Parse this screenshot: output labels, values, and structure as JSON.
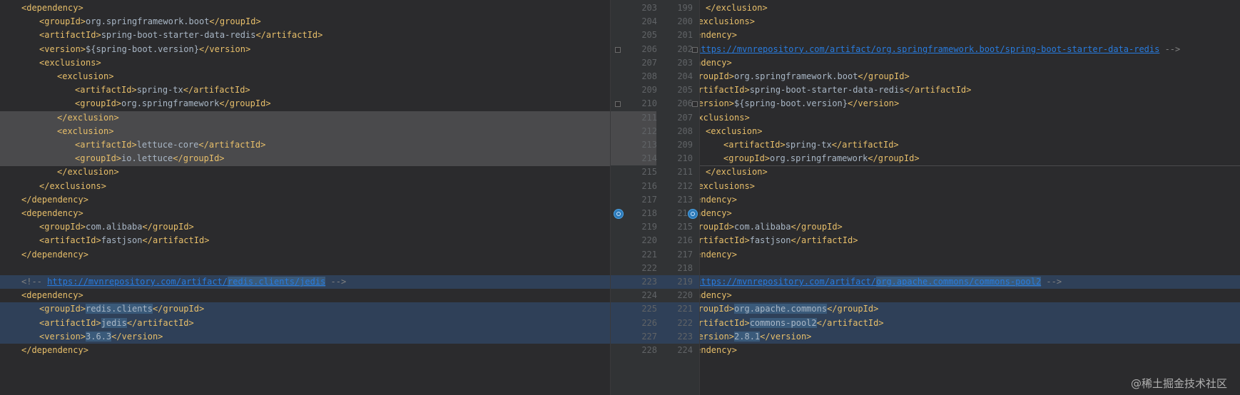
{
  "left_lines": [
    {
      "tokens": [
        {
          "t": "tag",
          "v": "<dependency>"
        }
      ],
      "indent": 0
    },
    {
      "tokens": [
        {
          "t": "tag",
          "v": "<groupId>"
        },
        {
          "t": "txt",
          "v": "org.springframework.boot"
        },
        {
          "t": "tag",
          "v": "</groupId>"
        }
      ],
      "indent": 1
    },
    {
      "tokens": [
        {
          "t": "tag",
          "v": "<artifactId>"
        },
        {
          "t": "txt",
          "v": "spring-boot-starter-data-redis"
        },
        {
          "t": "tag",
          "v": "</artifactId>"
        }
      ],
      "indent": 1
    },
    {
      "tokens": [
        {
          "t": "tag",
          "v": "<version>"
        },
        {
          "t": "txt",
          "v": "${spring-boot.version}"
        },
        {
          "t": "tag",
          "v": "</version>"
        }
      ],
      "indent": 1
    },
    {
      "tokens": [
        {
          "t": "tag",
          "v": "<exclusions>"
        }
      ],
      "indent": 1
    },
    {
      "tokens": [
        {
          "t": "tag",
          "v": "<exclusion>"
        }
      ],
      "indent": 2
    },
    {
      "tokens": [
        {
          "t": "tag",
          "v": "<artifactId>"
        },
        {
          "t": "txt",
          "v": "spring-tx"
        },
        {
          "t": "tag",
          "v": "</artifactId>"
        }
      ],
      "indent": 3
    },
    {
      "tokens": [
        {
          "t": "tag",
          "v": "<groupId>"
        },
        {
          "t": "txt",
          "v": "org.springframework"
        },
        {
          "t": "tag",
          "v": "</groupId>"
        }
      ],
      "indent": 3
    },
    {
      "tokens": [
        {
          "t": "tag",
          "v": "</exclusion>"
        }
      ],
      "indent": 2,
      "bg": "del"
    },
    {
      "tokens": [
        {
          "t": "tag",
          "v": "<exclusion>"
        }
      ],
      "indent": 2,
      "bg": "del"
    },
    {
      "tokens": [
        {
          "t": "tag",
          "v": "<artifactId>"
        },
        {
          "t": "txt",
          "v": "lettuce-core"
        },
        {
          "t": "tag",
          "v": "</artifactId>"
        }
      ],
      "indent": 3,
      "bg": "del"
    },
    {
      "tokens": [
        {
          "t": "tag",
          "v": "<groupId>"
        },
        {
          "t": "txt",
          "v": "io.lettuce"
        },
        {
          "t": "tag",
          "v": "</groupId>"
        }
      ],
      "indent": 3,
      "bg": "del"
    },
    {
      "tokens": [
        {
          "t": "tag",
          "v": "</exclusion>"
        }
      ],
      "indent": 2
    },
    {
      "tokens": [
        {
          "t": "tag",
          "v": "</exclusions>"
        }
      ],
      "indent": 1
    },
    {
      "tokens": [
        {
          "t": "tag",
          "v": "</dependency>"
        }
      ],
      "indent": 0
    },
    {
      "tokens": [
        {
          "t": "tag",
          "v": "<dependency>"
        }
      ],
      "indent": 0
    },
    {
      "tokens": [
        {
          "t": "tag",
          "v": "<groupId>"
        },
        {
          "t": "txt",
          "v": "com.alibaba"
        },
        {
          "t": "tag",
          "v": "</groupId>"
        }
      ],
      "indent": 1
    },
    {
      "tokens": [
        {
          "t": "tag",
          "v": "<artifactId>"
        },
        {
          "t": "txt",
          "v": "fastjson"
        },
        {
          "t": "tag",
          "v": "</artifactId>"
        }
      ],
      "indent": 1
    },
    {
      "tokens": [
        {
          "t": "tag",
          "v": "</dependency>"
        }
      ],
      "indent": 0
    },
    {
      "tokens": [],
      "indent": 0
    },
    {
      "tokens": [
        {
          "t": "cmt",
          "v": "<!-- "
        },
        {
          "t": "link",
          "v": "https://mvnrepository.com/artifact/"
        },
        {
          "t": "link hl-tok",
          "v": "redis.clients/jedis"
        },
        {
          "t": "cmt",
          "v": " -->"
        }
      ],
      "indent": 0,
      "bg": "chg"
    },
    {
      "tokens": [
        {
          "t": "tag",
          "v": "<dependency>"
        }
      ],
      "indent": 0
    },
    {
      "tokens": [
        {
          "t": "tag",
          "v": "<groupId>"
        },
        {
          "t": "txt hl-tok",
          "v": "redis.clients"
        },
        {
          "t": "tag",
          "v": "</groupId>"
        }
      ],
      "indent": 1,
      "bg": "chg"
    },
    {
      "tokens": [
        {
          "t": "tag",
          "v": "<artifactId>"
        },
        {
          "t": "txt hl-tok",
          "v": "jedis"
        },
        {
          "t": "tag",
          "v": "</artifactId>"
        }
      ],
      "indent": 1,
      "bg": "chg"
    },
    {
      "tokens": [
        {
          "t": "tag",
          "v": "<version>"
        },
        {
          "t": "txt hl-tok",
          "v": "3.6.3"
        },
        {
          "t": "tag",
          "v": "</version>"
        }
      ],
      "indent": 1,
      "bg": "chg"
    },
    {
      "tokens": [
        {
          "t": "tag",
          "v": "</dependency>"
        }
      ],
      "indent": 0
    }
  ],
  "right_lines": [
    {
      "tokens": [
        {
          "t": "tag",
          "v": "</exclusion>"
        }
      ],
      "indent": 2
    },
    {
      "tokens": [
        {
          "t": "tag",
          "v": "</exclusions>"
        }
      ],
      "indent": 1
    },
    {
      "tokens": [
        {
          "t": "tag",
          "v": "</dependency>"
        }
      ],
      "indent": 0
    },
    {
      "tokens": [
        {
          "t": "cmt",
          "v": "<!-- "
        },
        {
          "t": "link",
          "v": "https://mvnrepository.com/artifact/org.springframework.boot/spring-boot-starter-data-redis"
        },
        {
          "t": "cmt",
          "v": " -->"
        }
      ],
      "indent": 0
    },
    {
      "tokens": [
        {
          "t": "tag",
          "v": "<dependency>"
        }
      ],
      "indent": 0
    },
    {
      "tokens": [
        {
          "t": "tag",
          "v": "<groupId>"
        },
        {
          "t": "txt",
          "v": "org.springframework.boot"
        },
        {
          "t": "tag",
          "v": "</groupId>"
        }
      ],
      "indent": 1
    },
    {
      "tokens": [
        {
          "t": "tag",
          "v": "<artifactId>"
        },
        {
          "t": "txt",
          "v": "spring-boot-starter-data-redis"
        },
        {
          "t": "tag",
          "v": "</artifactId>"
        }
      ],
      "indent": 1
    },
    {
      "tokens": [
        {
          "t": "tag",
          "v": "<version>"
        },
        {
          "t": "txt",
          "v": "${spring-boot.version}"
        },
        {
          "t": "tag",
          "v": "</version>"
        }
      ],
      "indent": 1
    },
    {
      "tokens": [
        {
          "t": "tag",
          "v": "<exclusions>"
        }
      ],
      "indent": 1
    },
    {
      "tokens": [
        {
          "t": "tag",
          "v": "<exclusion>"
        }
      ],
      "indent": 2
    },
    {
      "tokens": [
        {
          "t": "tag",
          "v": "<artifactId>"
        },
        {
          "t": "txt",
          "v": "spring-tx"
        },
        {
          "t": "tag",
          "v": "</artifactId>"
        }
      ],
      "indent": 3
    },
    {
      "tokens": [
        {
          "t": "tag",
          "v": "<groupId>"
        },
        {
          "t": "txt",
          "v": "org.springframework"
        },
        {
          "t": "tag",
          "v": "</groupId>"
        }
      ],
      "indent": 3
    },
    {
      "tokens": [
        {
          "t": "tag",
          "v": "</exclusion>"
        }
      ],
      "indent": 2
    },
    {
      "tokens": [
        {
          "t": "tag",
          "v": "</exclusions>"
        }
      ],
      "indent": 1
    },
    {
      "tokens": [
        {
          "t": "tag",
          "v": "</dependency>"
        }
      ],
      "indent": 0
    },
    {
      "tokens": [
        {
          "t": "tag",
          "v": "<dependency>"
        }
      ],
      "indent": 0
    },
    {
      "tokens": [
        {
          "t": "tag",
          "v": "<groupId>"
        },
        {
          "t": "txt",
          "v": "com.alibaba"
        },
        {
          "t": "tag",
          "v": "</groupId>"
        }
      ],
      "indent": 1
    },
    {
      "tokens": [
        {
          "t": "tag",
          "v": "<artifactId>"
        },
        {
          "t": "txt",
          "v": "fastjson"
        },
        {
          "t": "tag",
          "v": "</artifactId>"
        }
      ],
      "indent": 1
    },
    {
      "tokens": [
        {
          "t": "tag",
          "v": "</dependency>"
        }
      ],
      "indent": 0
    },
    {
      "tokens": [],
      "indent": 0
    },
    {
      "tokens": [
        {
          "t": "cmt",
          "v": "<!-- "
        },
        {
          "t": "link",
          "v": "https://mvnrepository.com/artifact/"
        },
        {
          "t": "link hl-tok",
          "v": "org.apache.commons/commons-pool2"
        },
        {
          "t": "cmt",
          "v": " -->"
        }
      ],
      "indent": 0,
      "bg": "chg"
    },
    {
      "tokens": [
        {
          "t": "tag",
          "v": "<dependency>"
        }
      ],
      "indent": 0
    },
    {
      "tokens": [
        {
          "t": "tag",
          "v": "<groupId>"
        },
        {
          "t": "txt hl-tok",
          "v": "org.apache.commons"
        },
        {
          "t": "tag",
          "v": "</groupId>"
        }
      ],
      "indent": 1,
      "bg": "chg"
    },
    {
      "tokens": [
        {
          "t": "tag",
          "v": "<artifactId>"
        },
        {
          "t": "txt hl-tok",
          "v": "commons-pool2"
        },
        {
          "t": "tag",
          "v": "</artifactId>"
        }
      ],
      "indent": 1,
      "bg": "chg"
    },
    {
      "tokens": [
        {
          "t": "tag",
          "v": "<version>"
        },
        {
          "t": "txt hl-tok",
          "v": "2.8.1"
        },
        {
          "t": "tag",
          "v": "</version>"
        }
      ],
      "indent": 1,
      "bg": "chg"
    },
    {
      "tokens": [
        {
          "t": "tag",
          "v": "</dependency>"
        }
      ],
      "indent": 0
    }
  ],
  "gutter_left_numbers": [
    "203",
    "204",
    "205",
    "206",
    "207",
    "208",
    "209",
    "210",
    "211",
    "212",
    "213",
    "214",
    "215",
    "216",
    "217",
    "218",
    "219",
    "220",
    "221",
    "222",
    "223",
    "224",
    "225",
    "226",
    "227",
    "228"
  ],
  "gutter_right_numbers": [
    "199",
    "200",
    "201",
    "202",
    "203",
    "204",
    "205",
    "206",
    "207",
    "208",
    "209",
    "210",
    "211",
    "212",
    "213",
    "214",
    "215",
    "216",
    "217",
    "218",
    "219",
    "220",
    "221",
    "222",
    "223",
    "224"
  ],
  "watermark": "@稀土掘金技术社区",
  "colors": {
    "tag": "#e8bf6a",
    "text": "#a9b7c6",
    "comment": "#808080",
    "link": "#287bde",
    "deleted_bg": "#4a4a4c",
    "changed_bg": "#2f4058"
  }
}
